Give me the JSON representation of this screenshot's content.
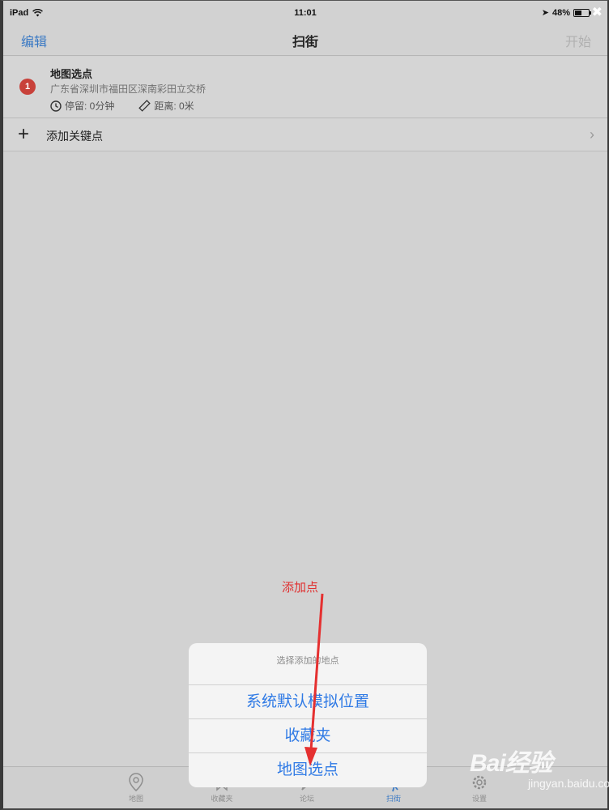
{
  "status_bar": {
    "device": "iPad",
    "time": "11:01",
    "battery": "48%",
    "battery_level": 0.48
  },
  "nav": {
    "edit": "编辑",
    "title": "扫街",
    "start": "开始"
  },
  "point": {
    "index": "1",
    "name": "地图选点",
    "address": "广东省深圳市福田区深南彩田立交桥",
    "stay": "停留: 0分钟",
    "distance": "距离: 0米"
  },
  "add_row": {
    "label": "添加关键点"
  },
  "annotation": "添加点",
  "sheet": {
    "title": "选择添加的地点",
    "options": [
      "系统默认模拟位置",
      "收藏夹",
      "地图选点"
    ]
  },
  "tabs": [
    {
      "label": "地图",
      "icon": "map-pin-icon"
    },
    {
      "label": "收藏夹",
      "icon": "bookmark-icon"
    },
    {
      "label": "论坛",
      "icon": "chat-icon"
    },
    {
      "label": "扫街",
      "icon": "walk-icon"
    },
    {
      "label": "设置",
      "icon": "gear-icon"
    }
  ],
  "watermark": {
    "logo": "Bai经验",
    "site": "jingyan.baidu.com"
  },
  "colors": {
    "accent": "#3a79c4",
    "badge": "#c8413a",
    "annotation": "#e03030"
  }
}
